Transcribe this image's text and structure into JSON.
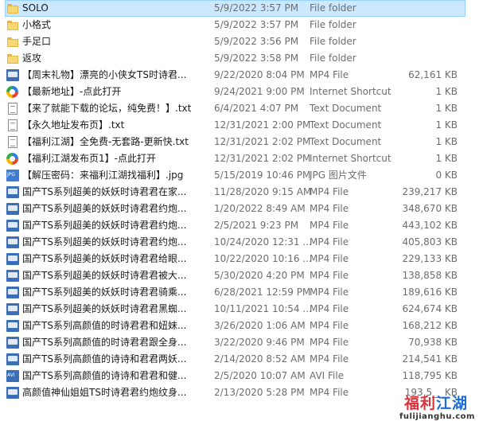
{
  "files": [
    {
      "name": "SOLO",
      "date": "5/9/2022 3:57 PM",
      "type": "File folder",
      "size": "",
      "icon": "folder-icon",
      "selected": true
    },
    {
      "name": "小格式",
      "date": "5/9/2022 3:57 PM",
      "type": "File folder",
      "size": "",
      "icon": "folder-icon"
    },
    {
      "name": "手足口",
      "date": "5/9/2022 3:56 PM",
      "type": "File folder",
      "size": "",
      "icon": "folder-icon"
    },
    {
      "name": "返攻",
      "date": "5/9/2022 3:58 PM",
      "type": "File folder",
      "size": "",
      "icon": "folder-icon"
    },
    {
      "name": "【周末礼物】漂亮的小侠女TS时诗君...",
      "date": "9/22/2020 8:04 PM",
      "type": "MP4 File",
      "size": "62,161 KB",
      "icon": "video-file-icon"
    },
    {
      "name": "【最新地址】-点此打开",
      "date": "9/24/2021 9:00 PM",
      "type": "Internet Shortcut",
      "size": "1 KB",
      "icon": "internet-shortcut-icon"
    },
    {
      "name": "【来了就能下载的论坛，纯免费！】.txt",
      "date": "6/4/2021 4:07 PM",
      "type": "Text Document",
      "size": "1 KB",
      "icon": "text-file-icon"
    },
    {
      "name": "【永久地址发布页】.txt",
      "date": "12/31/2021 2:00 PM",
      "type": "Text Document",
      "size": "1 KB",
      "icon": "text-file-icon"
    },
    {
      "name": "【福利江湖】全免费-无套路-更新快.txt",
      "date": "12/31/2021 2:02 PM",
      "type": "Text Document",
      "size": "1 KB",
      "icon": "text-file-icon"
    },
    {
      "name": "【福利江湖发布页1】-点此打开",
      "date": "12/31/2021 2:02 PM",
      "type": "Internet Shortcut",
      "size": "1 KB",
      "icon": "internet-shortcut-icon"
    },
    {
      "name": "【解压密码：来福利江湖找福利】.jpg",
      "date": "5/15/2019 10:46 PM",
      "type": "JPG 图片文件",
      "size": "0 KB",
      "icon": "jpg-file-icon"
    },
    {
      "name": "国产TS系列超美的妖妖时诗君君在家...",
      "date": "11/28/2020 9:15 AM",
      "type": "MP4 File",
      "size": "239,217 KB",
      "icon": "video-file-icon"
    },
    {
      "name": "国产TS系列超美的妖妖时诗君君约炮...",
      "date": "1/20/2022 8:49 AM",
      "type": "MP4 File",
      "size": "348,670 KB",
      "icon": "video-file-icon"
    },
    {
      "name": "国产TS系列超美的妖妖时诗君君约炮...",
      "date": "2/5/2021 9:23 PM",
      "type": "MP4 File",
      "size": "443,102 KB",
      "icon": "video-file-icon"
    },
    {
      "name": "国产TS系列超美的妖妖时诗君君约炮...",
      "date": "10/24/2020 12:31 ...",
      "type": "MP4 File",
      "size": "405,803 KB",
      "icon": "video-file-icon"
    },
    {
      "name": "国产TS系列超美的妖妖时诗君君给眼...",
      "date": "10/22/2020 10:16 ...",
      "type": "MP4 File",
      "size": "229,133 KB",
      "icon": "video-file-icon"
    },
    {
      "name": "国产TS系列超美的妖妖时诗君君被大...",
      "date": "5/30/2020 4:20 PM",
      "type": "MP4 File",
      "size": "138,858 KB",
      "icon": "video-file-icon"
    },
    {
      "name": "国产TS系列超美的妖妖时诗君君骑乘...",
      "date": "6/28/2021 12:59 PM",
      "type": "MP4 File",
      "size": "189,616 KB",
      "icon": "video-file-icon"
    },
    {
      "name": "国产TS系列超美的妖妖时诗君君黑蜘...",
      "date": "10/11/2021 10:54 ...",
      "type": "MP4 File",
      "size": "624,674 KB",
      "icon": "video-file-icon"
    },
    {
      "name": "国产TS系列高颜值的时诗君君和妞妹...",
      "date": "3/26/2020 1:06 AM",
      "type": "MP4 File",
      "size": "168,212 KB",
      "icon": "video-file-icon"
    },
    {
      "name": "国产TS系列高颜值的时诗君君跟全身...",
      "date": "3/22/2020 9:46 PM",
      "type": "MP4 File",
      "size": "70,938 KB",
      "icon": "video-file-icon"
    },
    {
      "name": "国产TS系列高颜值的诗诗和君君两妖...",
      "date": "2/14/2020 8:52 AM",
      "type": "MP4 File",
      "size": "214,541 KB",
      "icon": "video-file-icon"
    },
    {
      "name": "国产TS系列高颜值的诗诗和君君和健...",
      "date": "2/5/2020 10:07 AM",
      "type": "AVI File",
      "size": "118,795 KB",
      "icon": "avi-file-icon"
    },
    {
      "name": "高颜值神仙姐姐TS时诗君君约炮纹身...",
      "date": "2/13/2020 5:28 PM",
      "type": "MP4 File",
      "size": "193,5__ KB",
      "icon": "video-file-icon"
    }
  ],
  "watermark": {
    "title_part1": "福利",
    "title_part2": "江湖",
    "domain": "fulijianghu.com"
  }
}
